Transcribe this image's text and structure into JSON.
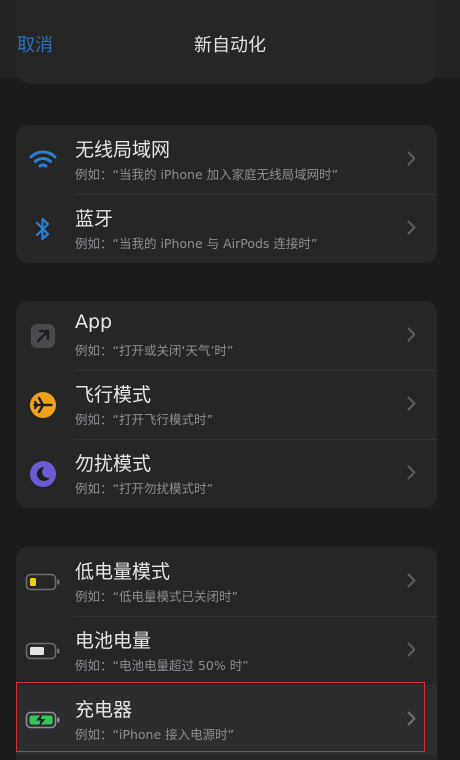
{
  "nav": {
    "cancel_label": "取消",
    "title": "新自动化"
  },
  "colors": {
    "accent": "#2f6fb7",
    "wifi": "#2a7fd6",
    "airplane": "#f0a21b",
    "dnd": "#6a5cd4",
    "charging": "#33c759",
    "low_power": "#f2cc0f"
  },
  "groups": [
    {
      "items": [
        {
          "icon": "wifi-icon",
          "title": "无线局域网",
          "subtitle": "例如：“当我的 iPhone 加入家庭无线局域网时”"
        },
        {
          "icon": "bluetooth-icon",
          "title": "蓝牙",
          "subtitle": "例如：“当我的 iPhone 与 AirPods 连接时”"
        }
      ]
    },
    {
      "items": [
        {
          "icon": "app-arrow-icon",
          "title": "App",
          "subtitle": "例如：“打开或关闭‘天气’时”"
        },
        {
          "icon": "airplane-icon",
          "title": "飞行模式",
          "subtitle": "例如：“打开飞行模式时”"
        },
        {
          "icon": "moon-icon",
          "title": "勿扰模式",
          "subtitle": "例如：“打开勿扰模式时”"
        }
      ]
    },
    {
      "items": [
        {
          "icon": "low-battery-icon",
          "title": "低电量模式",
          "subtitle": "例如：“低电量模式已关闭时”"
        },
        {
          "icon": "battery-icon",
          "title": "电池电量",
          "subtitle": "例如：“电池电量超过 50% 时”"
        },
        {
          "icon": "charging-battery-icon",
          "title": "充电器",
          "subtitle": "例如：“iPhone 接入电源时”"
        }
      ]
    }
  ]
}
